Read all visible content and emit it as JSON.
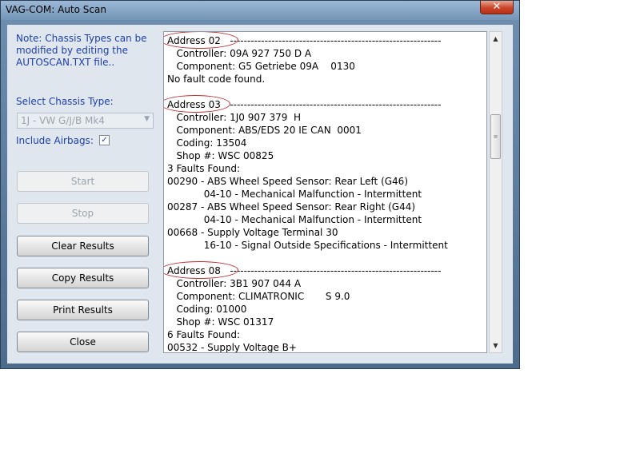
{
  "window": {
    "title": "VAG-COM: Auto Scan",
    "close_glyph": "✕"
  },
  "left_panel": {
    "note": "Note:  Chassis Types can be modified by editing the AUTOSCAN.TXT file..",
    "chassis_label": "Select Chassis Type:",
    "chassis_value": "1J - VW G/J/B Mk4",
    "airbags_label": "Include Airbags:",
    "airbags_checked": true,
    "buttons": {
      "start": "Start",
      "stop": "Stop",
      "clear": "Clear Results",
      "copy": "Copy Results",
      "print": "Print Results",
      "close": "Close"
    }
  },
  "results": {
    "lines": [
      "Address 02   -------------------------------------------------------------",
      "   Controller: 09A 927 750 D A",
      "   Component: G5 Getriebe 09A    0130",
      "No fault code found.",
      "Address 03   -------------------------------------------------------------",
      "   Controller: 1J0 907 379  H",
      "   Component: ABS/EDS 20 IE CAN  0001",
      "   Coding: 13504",
      "   Shop #: WSC 00825",
      "3 Faults Found:",
      "00290 - ABS Wheel Speed Sensor: Rear Left (G46)",
      "            04-10 - Mechanical Malfunction - Intermittent",
      "00287 - ABS Wheel Speed Sensor: Rear Right (G44)",
      "            04-10 - Mechanical Malfunction - Intermittent",
      "00668 - Supply Voltage Terminal 30",
      "            16-10 - Signal Outside Specifications - Intermittent",
      "Address 08   -------------------------------------------------------------",
      "   Controller: 3B1 907 044 A",
      "   Component: CLIMATRONIC       S 9.0",
      "   Coding: 01000",
      "   Shop #: WSC 01317",
      "6 Faults Found:",
      "00532 - Supply Voltage B+"
    ]
  },
  "colors": {
    "annotation": "#c0282c",
    "label_blue": "#1e3fa8"
  },
  "icons": {
    "scroll_up": "up-arrow-icon",
    "scroll_down": "down-arrow-icon",
    "thumb_grip": "grip-icon"
  }
}
